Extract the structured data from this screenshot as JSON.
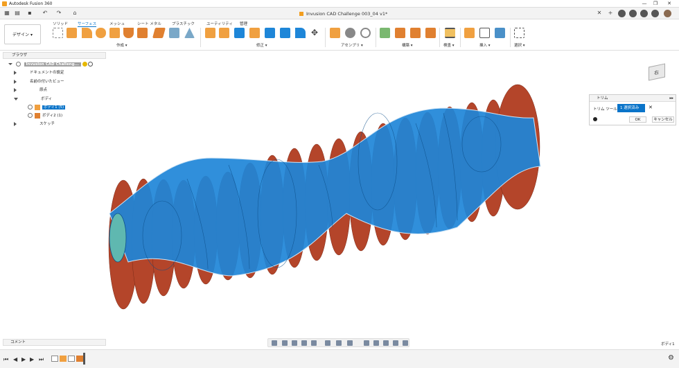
{
  "window": {
    "app_title": "Autodesk Fusion 360",
    "doc_title": "Invusion CAD Challenge 003_04 v1*"
  },
  "workspace": {
    "label": "デザイン ▾"
  },
  "tabs": [
    "ソリッド",
    "サーフェス",
    "メッシュ",
    "シート メタル",
    "プラスチック",
    "ユーティリティ",
    "管理"
  ],
  "active_tab": "サーフェス",
  "groups": [
    "作成 ▾",
    "修正 ▾",
    "アセンブリ ▾",
    "構築 ▾",
    "検査 ▾",
    "挿入 ▾",
    "選択 ▾"
  ],
  "browser": {
    "title": "ブラウザ",
    "root": "Invusion CAD Challeng...",
    "items": [
      {
        "label": "ドキュメントの設定"
      },
      {
        "label": "名前の付いたビュー"
      },
      {
        "label": "原点"
      },
      {
        "label": "ボディ"
      },
      {
        "label": "ボディ1 (5)"
      },
      {
        "label": "ボディ2 (1)"
      },
      {
        "label": "スケッチ"
      }
    ]
  },
  "trim_panel": {
    "title": "トリム",
    "tool_label": "トリム ツール",
    "selected": "1 選択済み",
    "ok": "OK",
    "cancel": "キャンセル"
  },
  "viewcube": {
    "face": "右",
    "face2": "前"
  },
  "comments": {
    "label": "コメント"
  },
  "status": {
    "selection": "ボディ1"
  },
  "colors": {
    "accent": "#0a74c9",
    "body_blue": "#1e86d8",
    "body_red": "#b4452a",
    "toolbar_bg": "#f3f3f3"
  }
}
